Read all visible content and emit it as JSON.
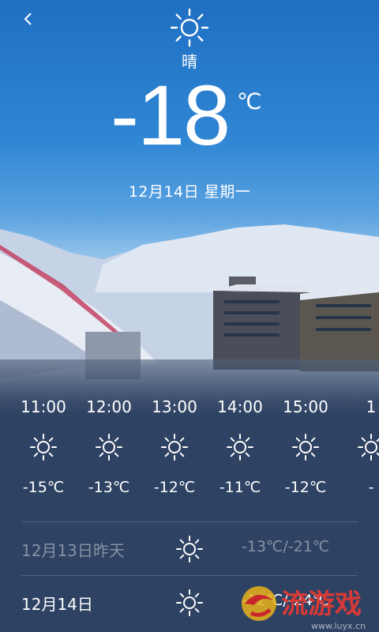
{
  "header": {
    "back_icon": "chevron-left-icon",
    "sun_icon": "sun-icon",
    "condition": "晴"
  },
  "current": {
    "temperature": "-18",
    "unit": "℃",
    "date": "12月14日 星期一"
  },
  "hourly": [
    {
      "time": "11:00",
      "icon": "sun-icon",
      "temp": "-15℃"
    },
    {
      "time": "12:00",
      "icon": "sun-icon",
      "temp": "-13℃"
    },
    {
      "time": "13:00",
      "icon": "sun-icon",
      "temp": "-12℃"
    },
    {
      "time": "14:00",
      "icon": "sun-icon",
      "temp": "-11℃"
    },
    {
      "time": "15:00",
      "icon": "sun-icon",
      "temp": "-12℃"
    },
    {
      "time": "1",
      "icon": "sun-icon",
      "temp": "-"
    }
  ],
  "daily": [
    {
      "label": "12月13日昨天",
      "icon": "sun-icon",
      "range": "-13℃/-21℃"
    },
    {
      "label": "12月14日",
      "icon": "sun-icon",
      "range": "-12℃/-24℃"
    }
  ],
  "watermark": {
    "text": "流游戏",
    "sub": "www.luyx.cn"
  }
}
